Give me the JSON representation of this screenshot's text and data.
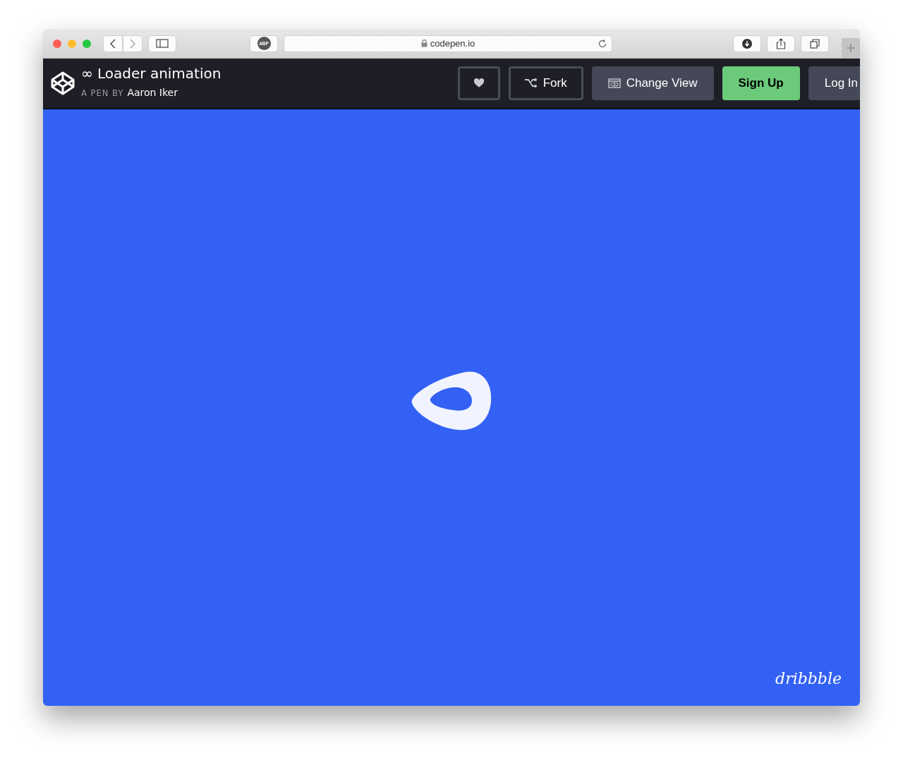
{
  "browser": {
    "extension_label": "ABP",
    "address": "codepen.io"
  },
  "pen": {
    "title": "∞ Loader animation",
    "byline_prefix": "A PEN BY",
    "author": "Aaron Iker"
  },
  "actions": [
    {
      "kind": "heart"
    },
    {
      "kind": "fork",
      "label": "Fork"
    },
    {
      "kind": "view",
      "label": "Change View"
    },
    {
      "kind": "signup",
      "label": "Sign Up"
    },
    {
      "kind": "login",
      "label": "Log In"
    }
  ],
  "preview": {
    "link": "dribbble"
  }
}
